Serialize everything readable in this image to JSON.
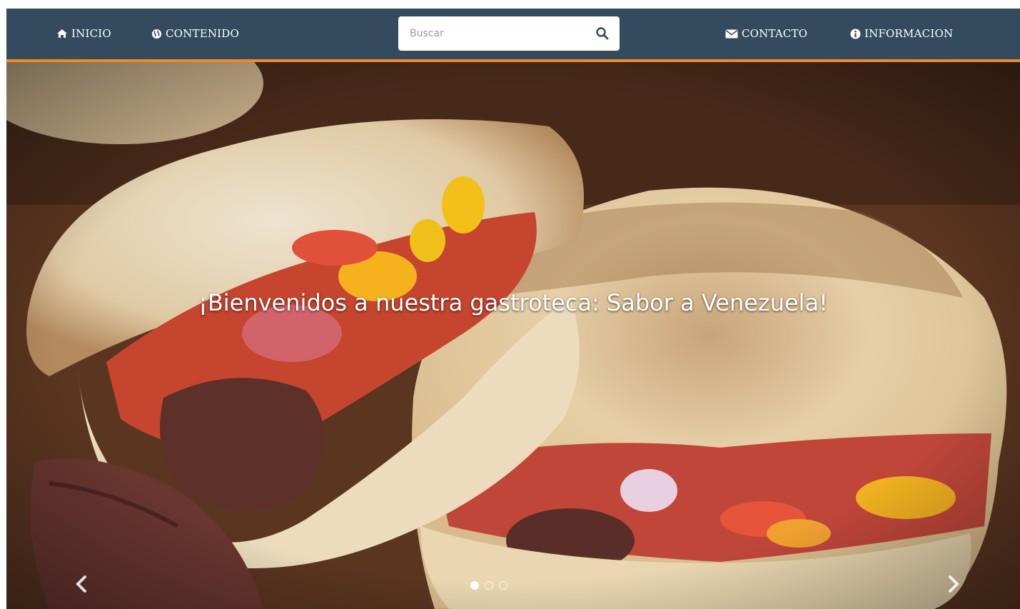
{
  "colors": {
    "navbar_bg": "#344a5f",
    "navbar_accent": "#f08a24",
    "nav_text": "#ffffff"
  },
  "nav": {
    "left_items": [
      {
        "label": "INICIO",
        "icon": "home-icon"
      },
      {
        "label": "CONTENIDO",
        "icon": "globe-icon"
      }
    ],
    "search": {
      "placeholder": "Buscar",
      "button_icon": "search-icon"
    },
    "right_items": [
      {
        "label": "CONTACTO",
        "icon": "envelope-icon"
      },
      {
        "label": "INFORMACION",
        "icon": "info-circle-icon"
      }
    ]
  },
  "carousel": {
    "caption": "¡Bienvenidos a nuestra gastroteca: Sabor a Venezuela!",
    "image": "arepas-with-beef-and-vegetables",
    "prev_icon": "chevron-left-icon",
    "next_icon": "chevron-right-icon",
    "slide_count": 3,
    "active_slide": 1
  }
}
